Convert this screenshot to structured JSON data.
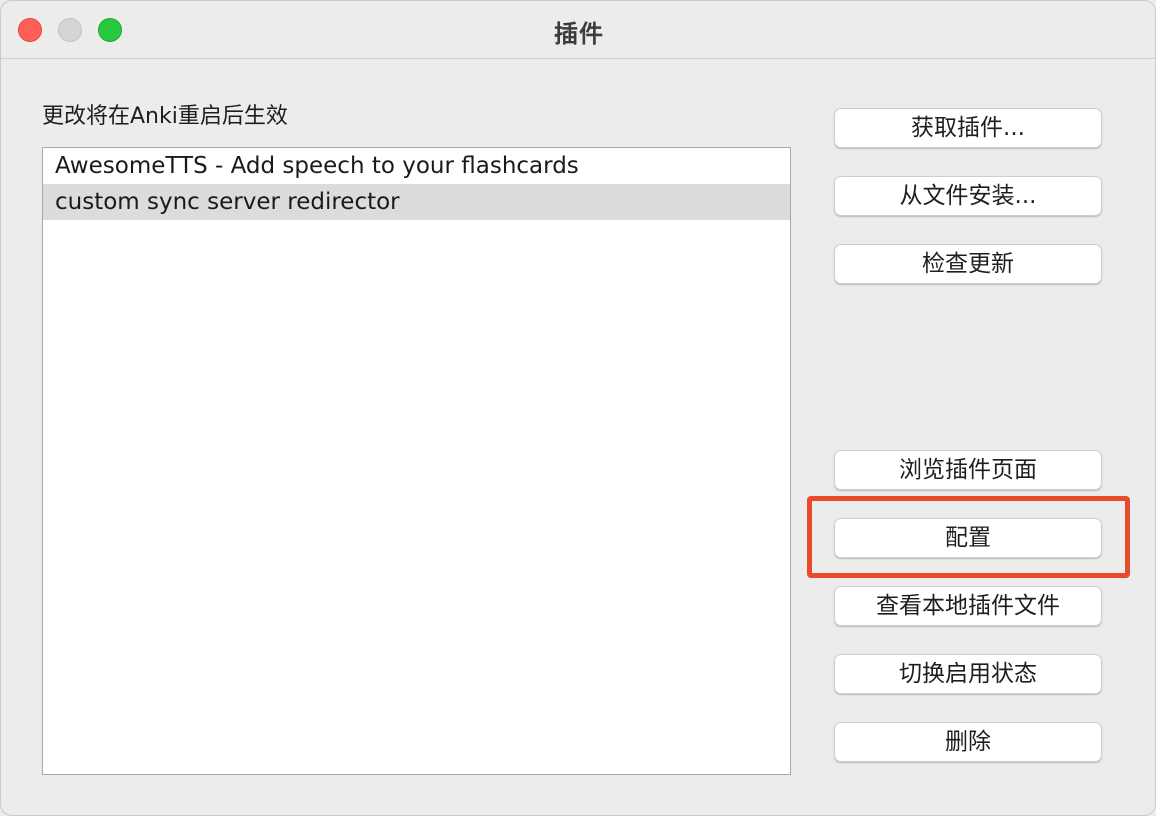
{
  "window": {
    "title": "插件"
  },
  "hint_text": "更改将在Anki重启后生效",
  "addons": [
    {
      "label": "AwesomeTTS - Add speech to your flashcards",
      "selected": false
    },
    {
      "label": "custom sync server redirector",
      "selected": true
    }
  ],
  "buttons": {
    "get_addons": "获取插件...",
    "install_from_file": "从文件安装...",
    "check_updates": "检查更新",
    "browse_addon_page": "浏览插件页面",
    "config": "配置",
    "view_files": "查看本地插件文件",
    "toggle_enabled": "切换启用状态",
    "delete": "删除"
  },
  "annotation": {
    "highlight_color": "#ea4a2c",
    "highlighted_button": "config"
  },
  "colors": {
    "window_bg": "#ececec",
    "selection_bg": "#dcdcdc",
    "close": "#fe5f57",
    "minimize": "#d5d5d5",
    "zoom": "#28c840"
  }
}
